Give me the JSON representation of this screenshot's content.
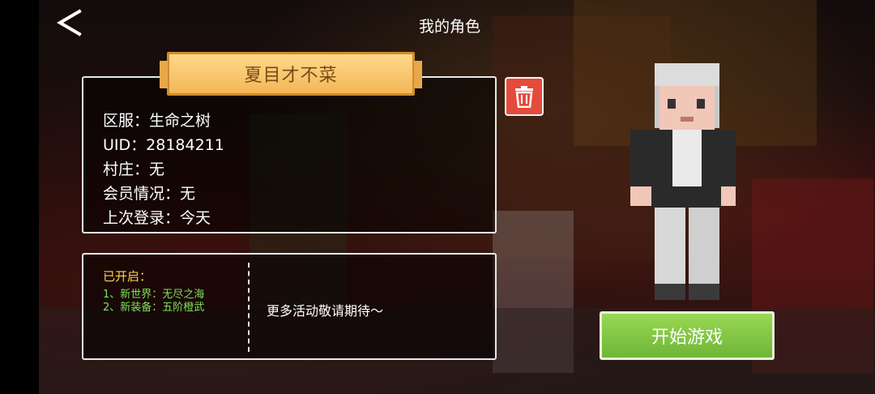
{
  "header": {
    "title": "我的角色"
  },
  "character": {
    "name": "夏目才不菜",
    "info": [
      {
        "label": "区服：",
        "value": "生命之树"
      },
      {
        "label": "UID：",
        "value": "28184211"
      },
      {
        "label": "村庄：",
        "value": "无"
      },
      {
        "label": "会员情况：",
        "value": "无"
      },
      {
        "label": "上次登录：",
        "value": "今天"
      }
    ]
  },
  "activities": {
    "opened_label": "已开启：",
    "items": [
      "1、新世界：无尽之海",
      "2、新装备：五阶橙武"
    ],
    "coming_soon": "更多活动敬请期待～"
  },
  "actions": {
    "start_label": "开始游戏"
  },
  "colors": {
    "accent_green": "#7fbf44",
    "delete_red": "#e54b3b",
    "banner_gold": "#f2b757",
    "highlight_yellow": "#ffd54a"
  },
  "icons": {
    "back": "chevron-left-icon",
    "delete": "trash-icon"
  }
}
